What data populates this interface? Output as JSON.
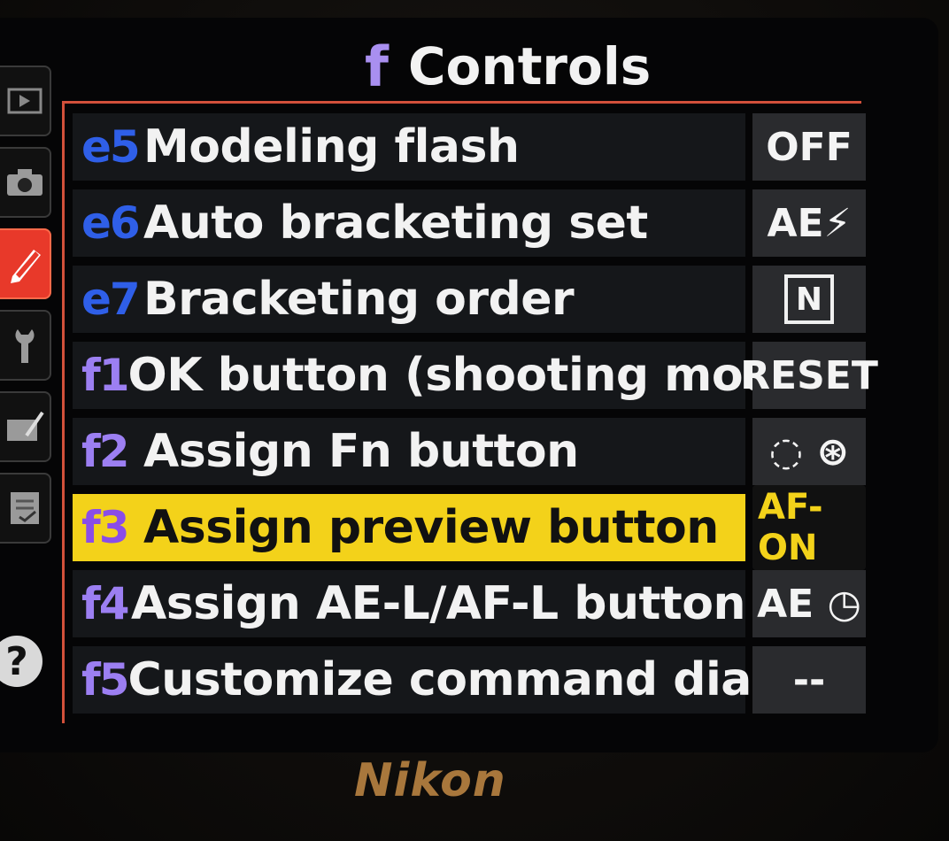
{
  "menu": {
    "title_glyph": "f",
    "title": "Controls"
  },
  "tabs": [
    {
      "name": "playback-menu-icon"
    },
    {
      "name": "camera-icon"
    },
    {
      "name": "pencil-icon",
      "active": true
    },
    {
      "name": "wrench-icon"
    },
    {
      "name": "retouch-icon"
    },
    {
      "name": "my-menu-icon"
    }
  ],
  "help": "?",
  "rows": [
    {
      "code": "e5",
      "label": "Modeling flash",
      "value": "OFF"
    },
    {
      "code": "e6",
      "label": "Auto bracketing set",
      "value": "AE⚡"
    },
    {
      "code": "e7",
      "label": "Bracketing order",
      "value": "N"
    },
    {
      "code": "f1",
      "label": "OK button (shooting mode)",
      "value": "RESET"
    },
    {
      "code": "f2",
      "label": "Assign Fn button",
      "value": "◌ ⊛"
    },
    {
      "code": "f3",
      "label": "Assign preview button",
      "value": "AF-ON"
    },
    {
      "code": "f4",
      "label": "Assign AE-L/AF-L button",
      "value": "AE ◷"
    },
    {
      "code": "f5",
      "label": "Customize command dials",
      "value": "--"
    }
  ],
  "brand": "Nikon",
  "colors": {
    "accent_selected": "#f3d21a",
    "code_e": "#2f5fe8",
    "code_f": "#9c7ff2",
    "active_tab": "#e8392a"
  }
}
